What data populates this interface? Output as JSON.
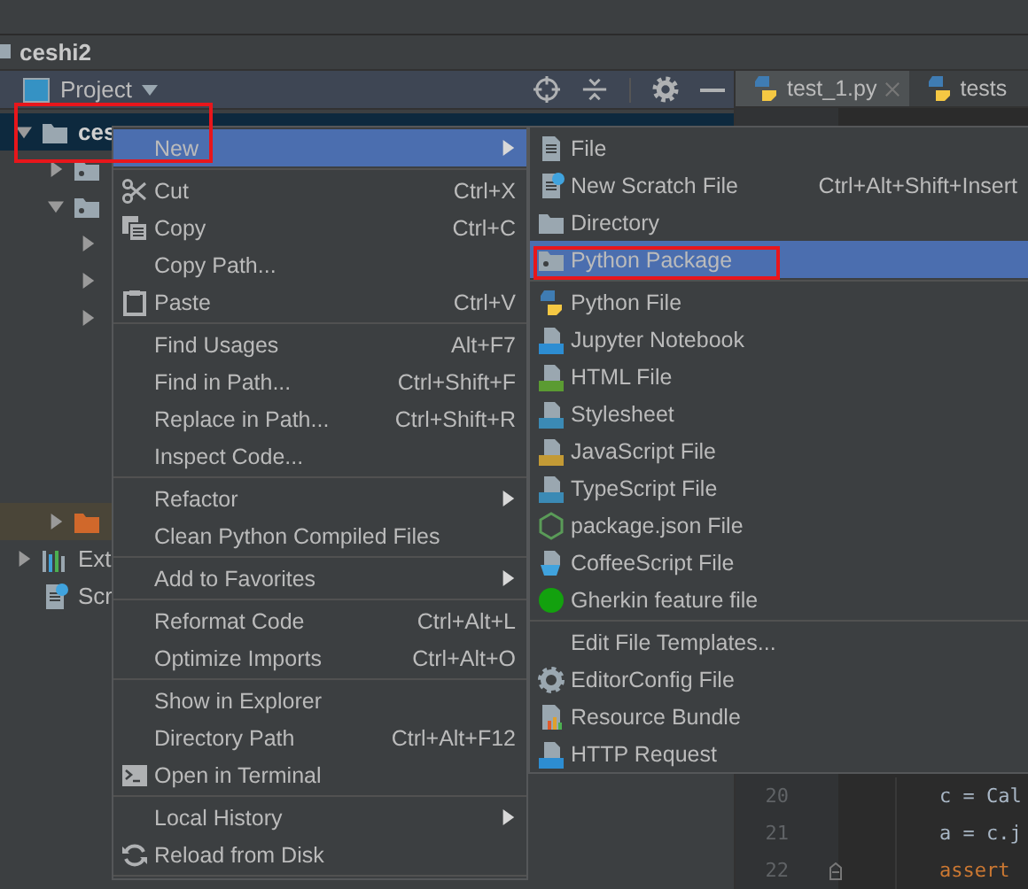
{
  "title_bar": {
    "title": "ceshi2"
  },
  "project_panel": {
    "title": "Project",
    "tree": [
      {
        "label": "ces",
        "kind": "project",
        "expanded": true,
        "selected": true,
        "children": [
          {
            "kind": "package",
            "expanded": false,
            "selected": false
          },
          {
            "kind": "package",
            "expanded": true,
            "selected": false,
            "children": [
              {
                "expanded": false,
                "selected": false
              },
              {
                "expanded": false,
                "selected": false
              },
              {
                "expanded": false,
                "selected": false
              }
            ]
          },
          {
            "kind": "excluded",
            "expanded": false,
            "selected": false
          }
        ]
      },
      {
        "label": "Ext",
        "kind": "libraries",
        "expanded": false,
        "selected": false
      },
      {
        "label": "Scr",
        "kind": "scratches",
        "selected": false
      }
    ]
  },
  "editor": {
    "tabs": [
      {
        "label": "test_1.py",
        "selected": true,
        "closable": true
      },
      {
        "label": "tests",
        "selected": false,
        "closable": false
      }
    ],
    "bottom_lines": [
      {
        "number": "20",
        "fold": false,
        "indented": true,
        "tokens": [
          {
            "text": "c = Cal",
            "kind": "plain"
          }
        ]
      },
      {
        "number": "21",
        "fold": false,
        "indented": true,
        "tokens": [
          {
            "text": "a = c.j",
            "kind": "plain"
          }
        ]
      },
      {
        "number": "22",
        "fold": true,
        "indented": true,
        "tokens": [
          {
            "text": "assert",
            "kind": "keyword"
          }
        ]
      }
    ]
  },
  "context_menu": {
    "items": [
      {
        "kind": "item",
        "label": "New",
        "submenu": true,
        "selected": true
      },
      {
        "kind": "separator"
      },
      {
        "kind": "item",
        "label": "Cut",
        "shortcut": "Ctrl+X",
        "submenu": false,
        "selected": false
      },
      {
        "kind": "item",
        "label": "Copy",
        "shortcut": "Ctrl+C",
        "submenu": false,
        "selected": false
      },
      {
        "kind": "item",
        "label": "Copy Path...",
        "submenu": false,
        "selected": false
      },
      {
        "kind": "item",
        "label": "Paste",
        "shortcut": "Ctrl+V",
        "submenu": false,
        "selected": false
      },
      {
        "kind": "separator"
      },
      {
        "kind": "item",
        "label": "Find Usages",
        "shortcut": "Alt+F7",
        "submenu": false,
        "selected": false
      },
      {
        "kind": "item",
        "label": "Find in Path...",
        "shortcut": "Ctrl+Shift+F",
        "submenu": false,
        "selected": false
      },
      {
        "kind": "item",
        "label": "Replace in Path...",
        "shortcut": "Ctrl+Shift+R",
        "submenu": false,
        "selected": false
      },
      {
        "kind": "item",
        "label": "Inspect Code...",
        "submenu": false,
        "selected": false
      },
      {
        "kind": "separator"
      },
      {
        "kind": "item",
        "label": "Refactor",
        "submenu": true,
        "selected": false
      },
      {
        "kind": "item",
        "label": "Clean Python Compiled Files",
        "submenu": false,
        "selected": false
      },
      {
        "kind": "separator"
      },
      {
        "kind": "item",
        "label": "Add to Favorites",
        "submenu": true,
        "selected": false
      },
      {
        "kind": "separator"
      },
      {
        "kind": "item",
        "label": "Reformat Code",
        "shortcut": "Ctrl+Alt+L",
        "submenu": false,
        "selected": false
      },
      {
        "kind": "item",
        "label": "Optimize Imports",
        "shortcut": "Ctrl+Alt+O",
        "submenu": false,
        "selected": false
      },
      {
        "kind": "separator"
      },
      {
        "kind": "item",
        "label": "Show in Explorer",
        "submenu": false,
        "selected": false
      },
      {
        "kind": "item",
        "label": "Directory Path",
        "shortcut": "Ctrl+Alt+F12",
        "submenu": false,
        "selected": false
      },
      {
        "kind": "item",
        "label": "Open in Terminal",
        "submenu": false,
        "selected": false
      },
      {
        "kind": "separator"
      },
      {
        "kind": "item",
        "label": "Local History",
        "submenu": true,
        "selected": false
      },
      {
        "kind": "item",
        "label": "Reload from Disk",
        "submenu": false,
        "selected": false
      },
      {
        "kind": "separator"
      }
    ]
  },
  "new_submenu": {
    "items": [
      {
        "kind": "item",
        "label": "File",
        "selected": false
      },
      {
        "kind": "item",
        "label": "New Scratch File",
        "shortcut": "Ctrl+Alt+Shift+Insert",
        "selected": false
      },
      {
        "kind": "item",
        "label": "Directory",
        "selected": false
      },
      {
        "kind": "item",
        "label": "Python Package",
        "selected": true
      },
      {
        "kind": "separator"
      },
      {
        "kind": "item",
        "label": "Python File",
        "selected": false
      },
      {
        "kind": "item",
        "label": "Jupyter Notebook",
        "selected": false
      },
      {
        "kind": "item",
        "label": "HTML File",
        "selected": false
      },
      {
        "kind": "item",
        "label": "Stylesheet",
        "selected": false
      },
      {
        "kind": "item",
        "label": "JavaScript File",
        "selected": false
      },
      {
        "kind": "item",
        "label": "TypeScript File",
        "selected": false
      },
      {
        "kind": "item",
        "label": "package.json File",
        "selected": false
      },
      {
        "kind": "item",
        "label": "CoffeeScript File",
        "selected": false
      },
      {
        "kind": "item",
        "label": "Gherkin feature file",
        "selected": false
      },
      {
        "kind": "separator"
      },
      {
        "kind": "item",
        "label": "Edit File Templates...",
        "selected": false
      },
      {
        "kind": "item",
        "label": "EditorConfig File",
        "selected": false
      },
      {
        "kind": "item",
        "label": "Resource Bundle",
        "selected": false
      },
      {
        "kind": "item",
        "label": "HTTP Request",
        "selected": false
      }
    ]
  },
  "annotations": [
    {
      "kind": "frame"
    },
    {
      "kind": "frame"
    }
  ]
}
